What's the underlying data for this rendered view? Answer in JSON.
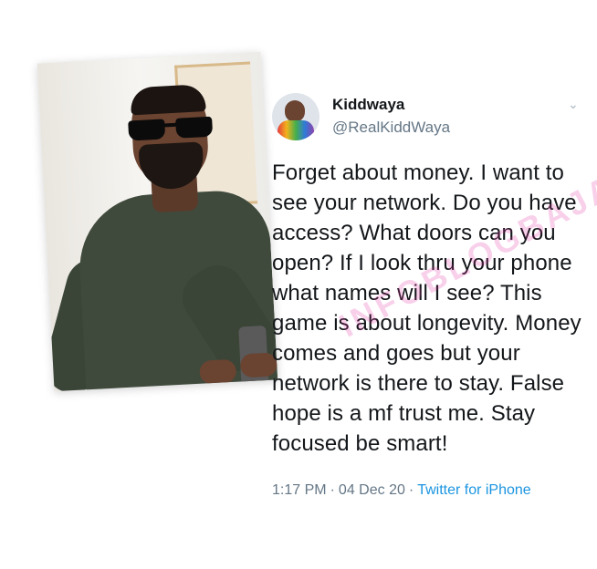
{
  "tweet": {
    "display_name": "Kiddwaya",
    "handle": "@RealKiddWaya",
    "text": "Forget about money. I want to see your network. Do you have access? What doors can you open? If I look thru your phone what names will I see? This game is about longevity. Money comes and goes but your network is there to stay. False hope is a mf trust me. Stay focused be smart!",
    "time": "1:17 PM",
    "date": "04 Dec 20",
    "source": "Twitter for iPhone",
    "separator": "·"
  },
  "watermark": {
    "text": "INFOBLOGBAJA"
  },
  "icons": {
    "menu": "chevron-down-icon",
    "avatar": "avatar-icon"
  },
  "colors": {
    "link": "#1b95e0",
    "muted": "#657786",
    "text": "#14171a",
    "watermark": "#e128a0"
  }
}
